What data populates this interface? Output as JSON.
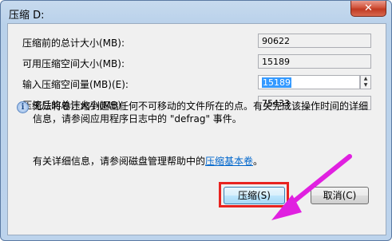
{
  "window": {
    "title": "压缩 D:",
    "close_glyph": "✕"
  },
  "fields": [
    {
      "label": "压缩前的总计大小(MB):",
      "value": "90622"
    },
    {
      "label": "可用压缩空间大小(MB):",
      "value": "15189"
    },
    {
      "label": "输入压缩空间量(MB)(E):",
      "value": "15189"
    },
    {
      "label": "压缩后的总计大小(MB):",
      "value": "75433"
    }
  ],
  "info": {
    "icon": "info-icon",
    "text": "无法将卷压缩到超出任何不可移动的文件所在的点。有关完成该操作时间的详细信息，请参阅应用程序日志中的 \"defrag\" 事件。"
  },
  "help": {
    "prefix": "有关详细信息，请参阅磁盘管理帮助中的",
    "link": "压缩基本卷",
    "suffix": "。"
  },
  "buttons": {
    "compress": "压缩(S)",
    "cancel": "取消(C)"
  },
  "annotation": {
    "highlight_color": "#e8231f",
    "arrow_color": "#e020e0"
  }
}
